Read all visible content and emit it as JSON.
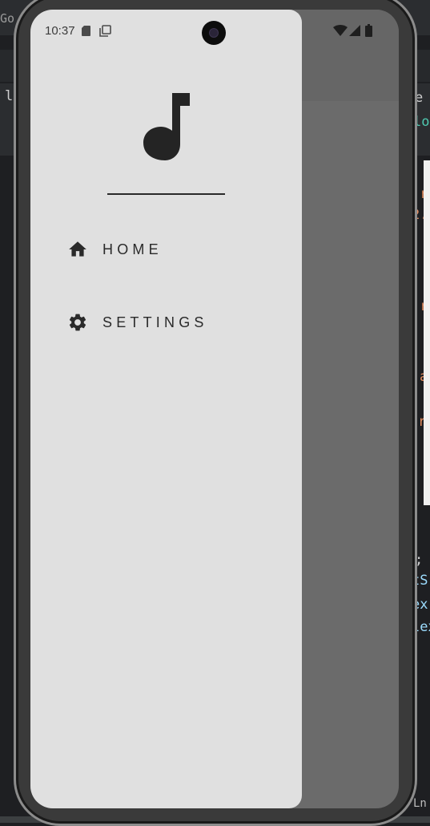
{
  "status_bar": {
    "time": "10:37"
  },
  "drawer": {
    "menu_items": [
      {
        "label": "HOME",
        "icon": "home-icon"
      },
      {
        "label": "SETTINGS",
        "icon": "gear-icon"
      }
    ]
  },
  "background_ide": {
    "fragments": [
      "Go",
      "li",
      "e",
      "lo",
      ".r",
      "2.",
      ".r",
      "a",
      "r",
      ";",
      "tS",
      "ex",
      "lex",
      "Ln"
    ]
  },
  "colors": {
    "drawer_background": "#e0e0e0",
    "scrim": "#6b6b6b",
    "text": "#2a2a2a"
  }
}
